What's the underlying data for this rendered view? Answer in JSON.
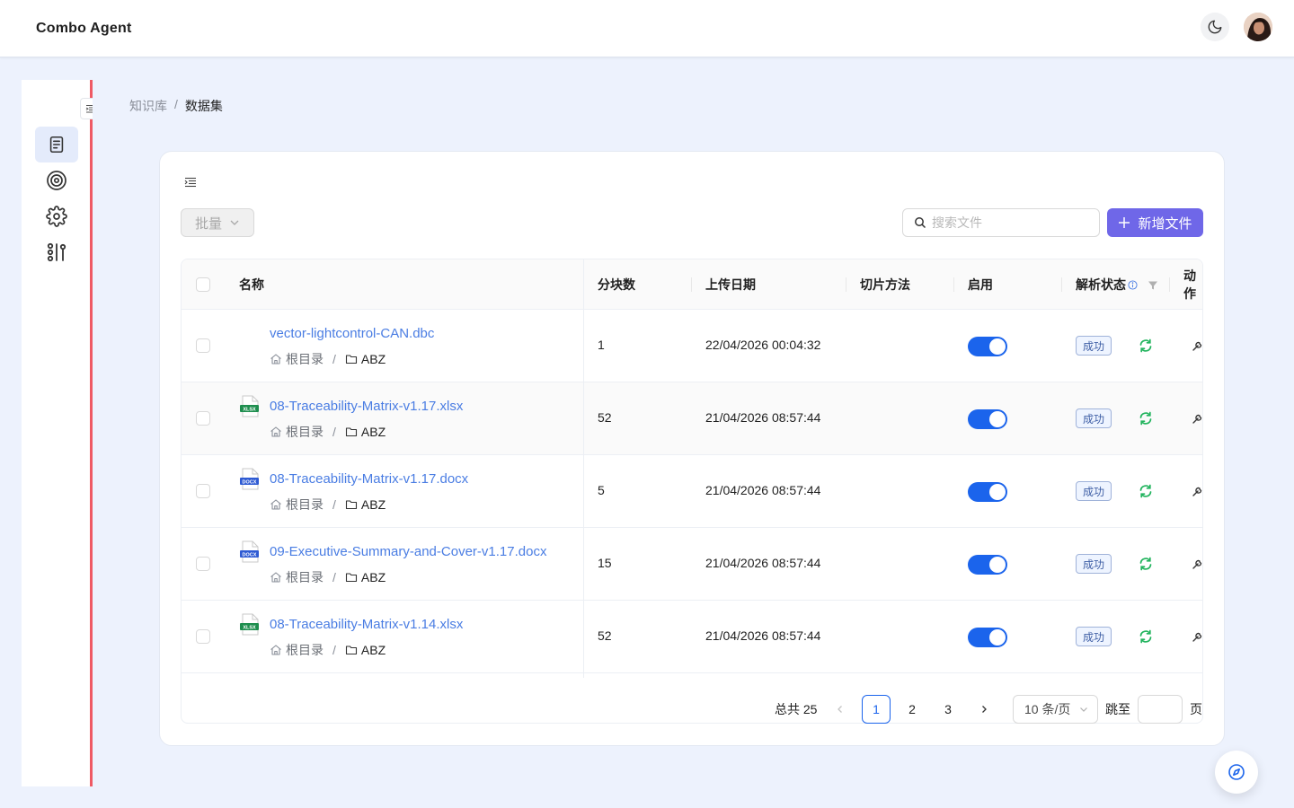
{
  "app": {
    "title": "Combo Agent"
  },
  "header": {
    "theme_icon": "moon-icon",
    "avatar": "user-avatar"
  },
  "sidebar": {
    "items": [
      {
        "icon": "document-icon",
        "active": true
      },
      {
        "icon": "target-icon",
        "active": false
      },
      {
        "icon": "gear-icon",
        "active": false
      },
      {
        "icon": "workflow-icon",
        "active": false
      }
    ]
  },
  "breadcrumb": {
    "root": "知识库",
    "separator": "/",
    "current": "数据集"
  },
  "toolbar": {
    "batch_label": "批量",
    "search_placeholder": "搜索文件",
    "add_label": "新增文件"
  },
  "table": {
    "columns": {
      "name": "名称",
      "chunks": "分块数",
      "upload_date": "上传日期",
      "chunk_method": "切片方法",
      "enabled": "启用",
      "parse_status": "解析状态",
      "action": "动作"
    },
    "rows": [
      {
        "name": "vector-lightcontrol-CAN.dbc",
        "type": "none",
        "path_root": "根目录",
        "path_folder": "ABZ",
        "chunks": "1",
        "date": "22/04/2026 00:04:32",
        "method": "",
        "enabled": true,
        "status": "成功"
      },
      {
        "name": "08-Traceability-Matrix-v1.17.xlsx",
        "type": "xlsx",
        "path_root": "根目录",
        "path_folder": "ABZ",
        "chunks": "52",
        "date": "21/04/2026 08:57:44",
        "method": "",
        "enabled": true,
        "status": "成功"
      },
      {
        "name": "08-Traceability-Matrix-v1.17.docx",
        "type": "docx",
        "path_root": "根目录",
        "path_folder": "ABZ",
        "chunks": "5",
        "date": "21/04/2026 08:57:44",
        "method": "",
        "enabled": true,
        "status": "成功"
      },
      {
        "name": "09-Executive-Summary-and-Cover-v1.17.docx",
        "type": "docx",
        "path_root": "根目录",
        "path_folder": "ABZ",
        "chunks": "15",
        "date": "21/04/2026 08:57:44",
        "method": "",
        "enabled": true,
        "status": "成功"
      },
      {
        "name": "08-Traceability-Matrix-v1.14.xlsx",
        "type": "xlsx",
        "path_root": "根目录",
        "path_folder": "ABZ",
        "chunks": "52",
        "date": "21/04/2026 08:57:44",
        "method": "",
        "enabled": true,
        "status": "成功"
      }
    ]
  },
  "pagination": {
    "total_label": "总共 25",
    "pages": [
      "1",
      "2",
      "3"
    ],
    "current": "1",
    "page_size": "10 条/页",
    "jump_label": "跳至",
    "page_suffix": "页"
  },
  "colors": {
    "accent": "#6f67e8",
    "primary": "#1b64ec",
    "link": "#4a7de3",
    "divider": "#ef5a64",
    "success": "#22b45e"
  }
}
